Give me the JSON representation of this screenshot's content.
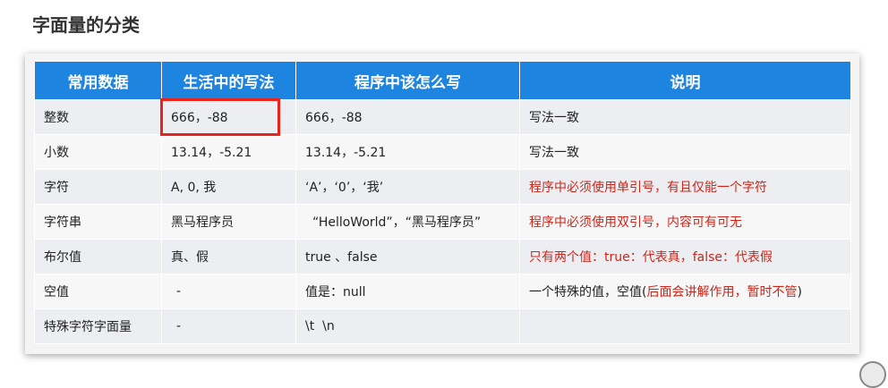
{
  "title": "字面量的分类",
  "table": {
    "headers": [
      "常用数据",
      "生活中的写法",
      "程序中该怎么写",
      "说明"
    ],
    "rows": [
      {
        "type": "整数",
        "life": "666，-88",
        "code": "666，-88",
        "desc": "写法一致"
      },
      {
        "type": "小数",
        "life": "13.14，-5.21",
        "code": "13.14，-5.21",
        "desc": "写法一致"
      },
      {
        "type": "字符",
        "life": "A, 0, 我",
        "code": "‘A’，‘0’，‘我’",
        "desc": "程序中必须使用单引号，有且仅能一个字符"
      },
      {
        "type": "字符串",
        "life": "黑马程序员",
        "code": "“HelloWorld”，“黑马程序员”",
        "desc": "程序中必须使用双引号，内容可有可无"
      },
      {
        "type": "布尔值",
        "life": "真、假",
        "code": "true 、false",
        "desc": "只有两个值：true：代表真，false：代表假"
      },
      {
        "type": "空值",
        "life": "-",
        "code": "值是：null",
        "desc_plain": "一个特殊的值，空值(",
        "desc_red": "后面会讲解作用，暂时不管",
        "desc_tail": ")"
      },
      {
        "type": "特殊字符字面量",
        "life": "-",
        "code": "\\t  \\n",
        "desc": ""
      }
    ]
  },
  "colors": {
    "header_bg": "#1d84e0",
    "highlight": "#e8231c",
    "note_red": "#d0261a"
  }
}
